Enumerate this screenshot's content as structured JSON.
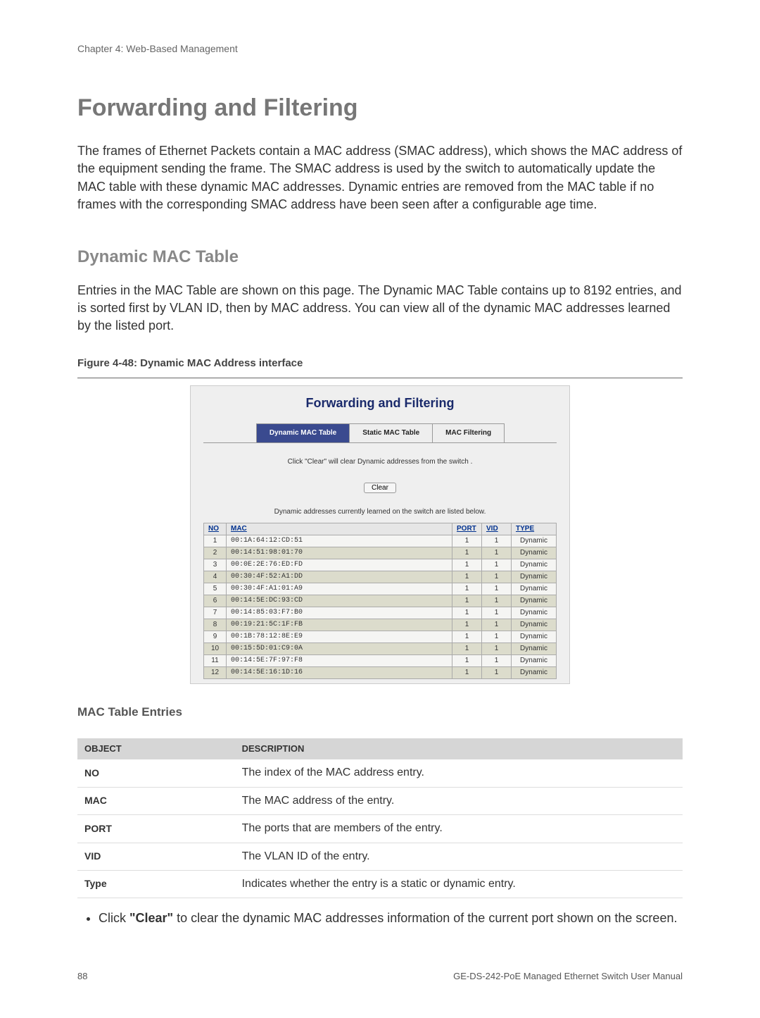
{
  "chapter_header": "Chapter 4: Web-Based Management",
  "h1": "Forwarding and Filtering",
  "intro_p": "The frames of Ethernet Packets contain a MAC address (SMAC address), which shows the MAC address of the equipment sending the frame. The SMAC address is used by the switch to automatically update the MAC table with these dynamic MAC addresses. Dynamic entries are removed from the MAC table if no frames with the corresponding SMAC address have been seen after a configurable age time.",
  "h2": "Dynamic MAC Table",
  "p2": "Entries in the MAC Table are shown on this page. The Dynamic MAC Table contains up to 8192 entries, and is sorted first by VLAN ID, then by MAC address. You can view all of the dynamic MAC addresses learned by the listed port.",
  "figure_caption": "Figure 4-48: Dynamic MAC Address interface",
  "screenshot": {
    "title": "Forwarding and Filtering",
    "tabs": [
      "Dynamic MAC Table",
      "Static MAC Table",
      "MAC Filtering"
    ],
    "active_tab": 0,
    "hint": "Click \"Clear\" will clear Dynamic addresses from the switch .",
    "clear_label": "Clear",
    "subhint": "Dynamic addresses currently learned on the switch are listed below.",
    "headers": [
      "NO",
      "MAC",
      "PORT",
      "VID",
      "TYPE"
    ],
    "rows": [
      {
        "no": "1",
        "mac": "00:1A:64:12:CD:51",
        "port": "1",
        "vid": "1",
        "type": "Dynamic"
      },
      {
        "no": "2",
        "mac": "00:14:51:98:01:70",
        "port": "1",
        "vid": "1",
        "type": "Dynamic"
      },
      {
        "no": "3",
        "mac": "00:0E:2E:76:ED:FD",
        "port": "1",
        "vid": "1",
        "type": "Dynamic"
      },
      {
        "no": "4",
        "mac": "00:30:4F:52:A1:DD",
        "port": "1",
        "vid": "1",
        "type": "Dynamic"
      },
      {
        "no": "5",
        "mac": "00:30:4F:A1:01:A9",
        "port": "1",
        "vid": "1",
        "type": "Dynamic"
      },
      {
        "no": "6",
        "mac": "00:14:5E:DC:93:CD",
        "port": "1",
        "vid": "1",
        "type": "Dynamic"
      },
      {
        "no": "7",
        "mac": "00:14:85:03:F7:B0",
        "port": "1",
        "vid": "1",
        "type": "Dynamic"
      },
      {
        "no": "8",
        "mac": "00:19:21:5C:1F:FB",
        "port": "1",
        "vid": "1",
        "type": "Dynamic"
      },
      {
        "no": "9",
        "mac": "00:1B:78:12:8E:E9",
        "port": "1",
        "vid": "1",
        "type": "Dynamic"
      },
      {
        "no": "10",
        "mac": "00:15:5D:01:C9:0A",
        "port": "1",
        "vid": "1",
        "type": "Dynamic"
      },
      {
        "no": "11",
        "mac": "00:14:5E:7F:97:F8",
        "port": "1",
        "vid": "1",
        "type": "Dynamic"
      },
      {
        "no": "12",
        "mac": "00:14:5E:16:1D:16",
        "port": "1",
        "vid": "1",
        "type": "Dynamic"
      }
    ]
  },
  "entries_heading": "MAC Table Entries",
  "desc_headers": [
    "OBJECT",
    "DESCRIPTION"
  ],
  "desc_rows": [
    {
      "obj": "NO",
      "desc": "The index of the MAC address entry."
    },
    {
      "obj": "MAC",
      "desc": "The MAC address of the entry."
    },
    {
      "obj": "PORT",
      "desc": "The ports that are members of the entry."
    },
    {
      "obj": "VID",
      "desc": "The VLAN ID of the entry."
    },
    {
      "obj": "Type",
      "desc": "Indicates whether the entry is a static or dynamic entry."
    }
  ],
  "bullet_prefix": "Click ",
  "bullet_bold": "\"Clear\"",
  "bullet_suffix": " to clear the dynamic MAC addresses information of the current port shown on the screen.",
  "footer_left": "88",
  "footer_right": "GE-DS-242-PoE Managed Ethernet Switch User Manual"
}
